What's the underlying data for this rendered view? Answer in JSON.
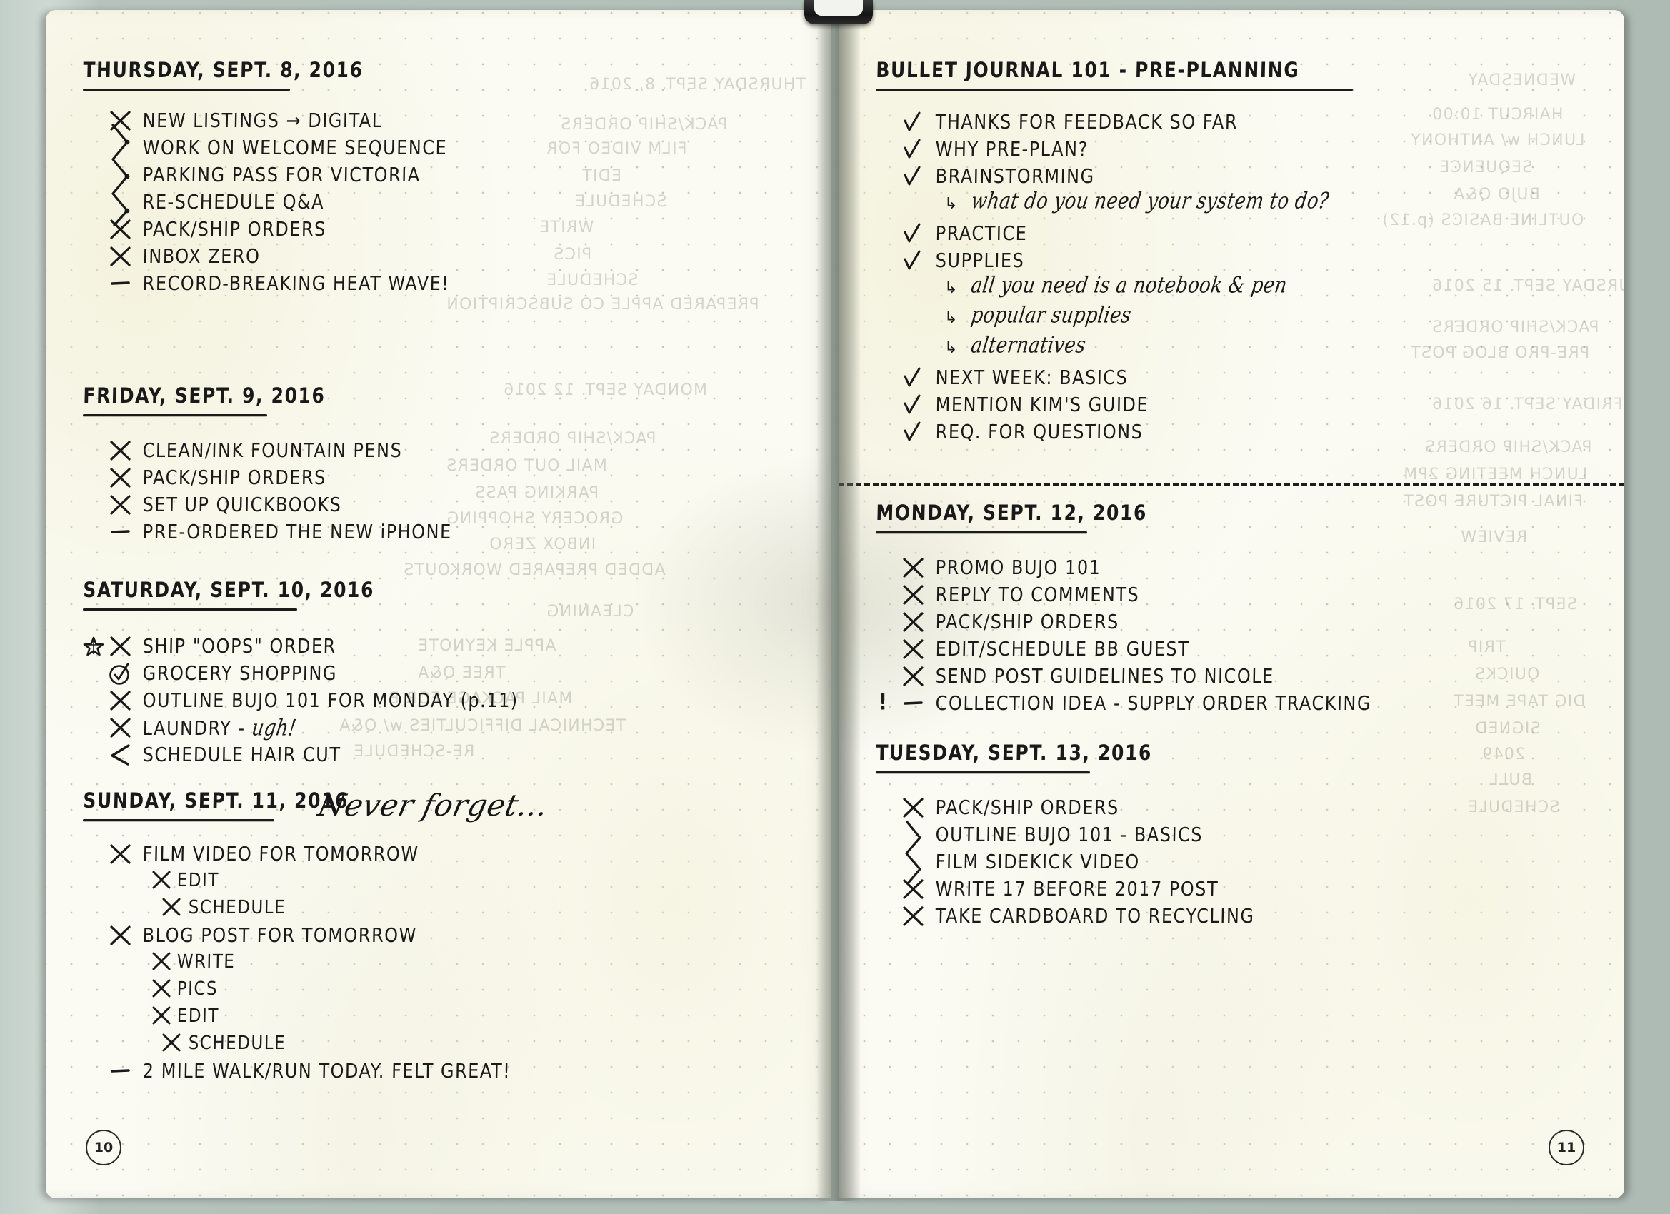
{
  "notebook": {
    "left_page_number": "10",
    "right_page_number": "11"
  },
  "left_page": {
    "days": [
      {
        "title": "THURSDAY, SEPT. 8, 2016",
        "items": [
          {
            "marker": "x",
            "text": "NEW LISTINGS → DIGITAL"
          },
          {
            "marker": "migrate-zigzag",
            "text": "WORK ON WELCOME SEQUENCE"
          },
          {
            "marker": "migrate-zigzag",
            "text": "PARKING PASS FOR VICTORIA"
          },
          {
            "marker": "migrate-zigzag",
            "text": "RE-SCHEDULE Q&A"
          },
          {
            "marker": "x",
            "text": "PACK/SHIP ORDERS"
          },
          {
            "marker": "x",
            "text": "INBOX ZERO"
          },
          {
            "marker": "dash",
            "text": "RECORD-BREAKING HEAT WAVE!"
          }
        ]
      },
      {
        "title": "FRIDAY, SEPT. 9, 2016",
        "items": [
          {
            "marker": "x",
            "text": "CLEAN/INK FOUNTAIN PENS"
          },
          {
            "marker": "x",
            "text": "PACK/SHIP ORDERS"
          },
          {
            "marker": "x",
            "text": "SET UP QUICKBOOKS"
          },
          {
            "marker": "dash",
            "text": "PRE-ORDERED THE NEW iPHONE"
          }
        ]
      },
      {
        "title": "SATURDAY, SEPT. 10, 2016",
        "items": [
          {
            "marker": "x",
            "signifier": "star",
            "text": "SHIP \"OOPS\" ORDER"
          },
          {
            "marker": "circled-check",
            "text": "GROCERY SHOPPING"
          },
          {
            "marker": "x",
            "text": "OUTLINE BUJO 101 FOR MONDAY (p.11)"
          },
          {
            "marker": "x",
            "text": "LAUNDRY - ",
            "cursive_suffix": "ugh!"
          },
          {
            "marker": "arrow-left",
            "text": "SCHEDULE HAIR CUT"
          }
        ]
      },
      {
        "title": "SUNDAY, SEPT. 11, 2016",
        "annotation": "Never forget...",
        "items": [
          {
            "marker": "x",
            "text": "FILM VIDEO FOR TOMORROW"
          },
          {
            "marker": "x",
            "indent": 1,
            "text": "EDIT"
          },
          {
            "marker": "x",
            "indent": 1,
            "text": "SCHEDULE"
          },
          {
            "marker": "x",
            "text": "BLOG POST FOR TOMORROW"
          },
          {
            "marker": "x",
            "indent": 1,
            "text": "WRITE"
          },
          {
            "marker": "x",
            "indent": 1,
            "text": "PICS"
          },
          {
            "marker": "x",
            "indent": 1,
            "text": "EDIT"
          },
          {
            "marker": "x",
            "indent": 1,
            "text": "SCHEDULE"
          },
          {
            "marker": "dash",
            "text": "2 MILE WALK/RUN TODAY. FELT GREAT!"
          }
        ]
      }
    ]
  },
  "right_page": {
    "days": [
      {
        "title": "BULLET JOURNAL 101 - PRE-PLANNING",
        "items": [
          {
            "marker": "check",
            "text": "THANKS FOR FEEDBACK SO FAR"
          },
          {
            "marker": "check",
            "text": "WHY PRE-PLAN?"
          },
          {
            "marker": "check",
            "text": "BRAINSTORMING"
          },
          {
            "marker": "sub-arrow",
            "cursive": "what do you need your system to do?"
          },
          {
            "marker": "check",
            "text": "PRACTICE"
          },
          {
            "marker": "check",
            "text": "SUPPLIES"
          },
          {
            "marker": "sub-arrow",
            "cursive": "all you need is a notebook & pen"
          },
          {
            "marker": "sub-arrow",
            "cursive": "popular supplies"
          },
          {
            "marker": "sub-arrow",
            "cursive": "alternatives"
          },
          {
            "marker": "check",
            "text": "NEXT WEEK: BASICS"
          },
          {
            "marker": "check",
            "text": "MENTION KIM'S GUIDE"
          },
          {
            "marker": "check",
            "text": "REQ. FOR QUESTIONS"
          }
        ]
      },
      {
        "title": "MONDAY, SEPT. 12, 2016",
        "items": [
          {
            "marker": "x",
            "text": "PROMO BUJO 101"
          },
          {
            "marker": "x",
            "text": "REPLY TO COMMENTS"
          },
          {
            "marker": "x",
            "text": "PACK/SHIP ORDERS"
          },
          {
            "marker": "x",
            "text": "EDIT/SCHEDULE BB GUEST"
          },
          {
            "marker": "x",
            "text": "SEND POST GUIDELINES TO NICOLE"
          },
          {
            "marker": "dash",
            "signifier": "priority",
            "text": "COLLECTION IDEA - SUPPLY ORDER TRACKING"
          }
        ]
      },
      {
        "title": "TUESDAY, SEPT. 13, 2016",
        "items": [
          {
            "marker": "x",
            "text": "PACK/SHIP ORDERS"
          },
          {
            "marker": "migrate-zigzag",
            "text": "OUTLINE BUJO 101 - BASICS"
          },
          {
            "marker": "migrate-zigzag",
            "text": "FILM SIDEKICK VIDEO"
          },
          {
            "marker": "x",
            "text": "WRITE 17 BEFORE 2017 POST"
          },
          {
            "marker": "x",
            "text": "TAKE CARDBOARD TO RECYCLING"
          }
        ]
      }
    ]
  }
}
